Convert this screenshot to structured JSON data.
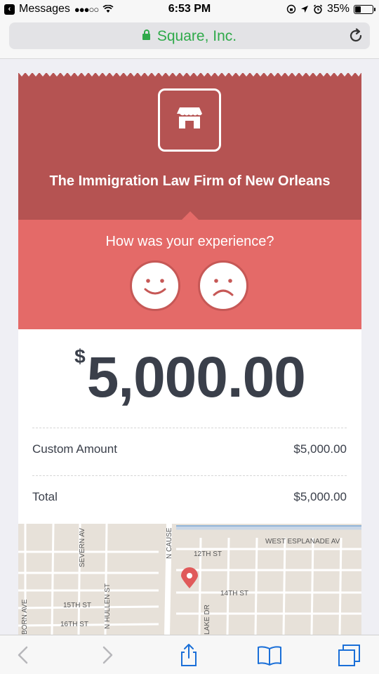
{
  "status_bar": {
    "carrier": "Messages",
    "time": "6:53 PM",
    "battery": "35%",
    "battery_level": 0.35
  },
  "browser": {
    "url_title": "Square, Inc.",
    "secure": true
  },
  "receipt": {
    "merchant_name": "The Immigration Law Firm of New Orleans",
    "feedback_question": "How was your experience?",
    "currency_symbol": "$",
    "total_display": "5,000.00",
    "line_items": [
      {
        "label": "Custom Amount",
        "value": "$5,000.00"
      },
      {
        "label": "Total",
        "value": "$5,000.00"
      }
    ]
  },
  "map": {
    "street_labels": [
      "WEST ESPLANADE AV",
      "12TH ST",
      "14TH ST",
      "15TH ST",
      "16TH ST",
      "N CAUSE",
      "SEVERN AV",
      "N HULLEN ST",
      "LAKE DR",
      "BORN AVE"
    ],
    "pin_color": "#e05a5a"
  },
  "colors": {
    "merchant_bg": "#b55352",
    "feedback_bg": "#e46a68",
    "secure_green": "#2faa4a",
    "ios_blue": "#1a6fd8"
  }
}
